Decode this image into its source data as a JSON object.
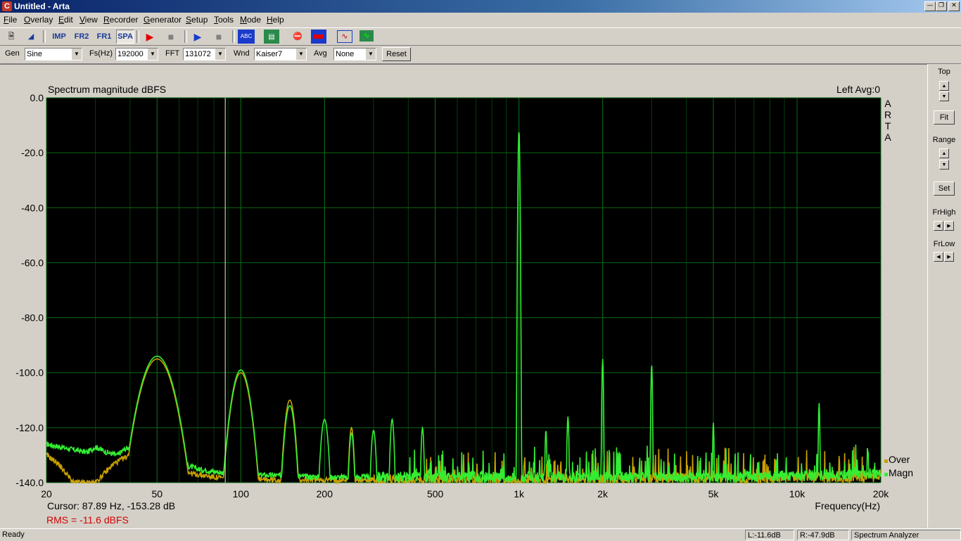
{
  "window": {
    "title": "Untitled - Arta",
    "app_icon": "C",
    "controls": [
      "minimize-icon",
      "restore-icon",
      "close-icon"
    ]
  },
  "menu": [
    {
      "label": "File",
      "u": "F",
      "rest": "ile"
    },
    {
      "label": "Overlay",
      "u": "O",
      "rest": "verlay"
    },
    {
      "label": "Edit",
      "u": "E",
      "rest": "dit"
    },
    {
      "label": "View",
      "u": "V",
      "rest": "iew"
    },
    {
      "label": "Recorder",
      "u": "R",
      "rest": "ecorder"
    },
    {
      "label": "Generator",
      "u": "G",
      "rest": "enerator"
    },
    {
      "label": "Setup",
      "u": "S",
      "rest": "etup"
    },
    {
      "label": "Tools",
      "u": "T",
      "rest": "ools"
    },
    {
      "label": "Mode",
      "u": "M",
      "rest": "ode"
    },
    {
      "label": "Help",
      "u": "H",
      "rest": "elp"
    }
  ],
  "toolbar": {
    "imp_label": "IMP",
    "fr2_label": "FR2",
    "fr1_label": "FR1",
    "spa_label": "SPA",
    "abc_label": "ABC"
  },
  "params": {
    "gen_label": "Gen",
    "gen_value": "Sine",
    "fs_label": "Fs(Hz)",
    "fs_value": "192000",
    "fft_label": "FFT",
    "fft_value": "131072",
    "wnd_label": "Wnd",
    "wnd_value": "Kaiser7",
    "avg_label": "Avg",
    "avg_value": "None",
    "reset_label": "Reset"
  },
  "chart": {
    "title": "Spectrum magnitude dBFS",
    "channel_info": "Left  Avg:0",
    "watermark": [
      "A",
      "R",
      "T",
      "A"
    ],
    "cursor_text": "Cursor: 87.89 Hz, -153.28 dB",
    "rms_text": "RMS =  -11.6 dBFS",
    "xlabel": "Frequency(Hz)",
    "legend": [
      {
        "name": "Over",
        "color": "#c8a000"
      },
      {
        "name": "Magn",
        "color": "#33ee33"
      }
    ],
    "colors": {
      "background": "#000000",
      "grid": "#0a6a14",
      "cursor": "#f0f0c8",
      "magn": "#33ee33",
      "over": "#c8a000",
      "rms": "#d40000"
    }
  },
  "chart_data": {
    "type": "line",
    "title": "Spectrum magnitude dBFS",
    "xlabel": "Frequency(Hz)",
    "ylabel": "",
    "x_scale": "log",
    "xlim": [
      20,
      20000
    ],
    "ylim": [
      -140,
      0
    ],
    "x_ticks": [
      20,
      50,
      100,
      200,
      500,
      1000,
      2000,
      5000,
      10000,
      20000
    ],
    "x_tick_labels": [
      "20",
      "50",
      "100",
      "200",
      "500",
      "1k",
      "2k",
      "5k",
      "10k",
      "20k"
    ],
    "y_ticks": [
      0,
      -20,
      -40,
      -60,
      -80,
      -100,
      -120,
      -140
    ],
    "y_tick_labels": [
      "0.0",
      "-20.0",
      "-40.0",
      "-60.0",
      "-80.0",
      "-100.0",
      "-120.0",
      "-140.0"
    ],
    "grid": true,
    "cursor_x": 87.89,
    "series": [
      {
        "name": "Magn",
        "color": "#33ee33",
        "baseline_points": [
          [
            20,
            -126
          ],
          [
            25,
            -128
          ],
          [
            28,
            -129
          ],
          [
            30,
            -127
          ],
          [
            33,
            -129
          ],
          [
            36,
            -130
          ],
          [
            38,
            -128
          ],
          [
            40,
            -127
          ],
          [
            42,
            -128
          ],
          [
            45,
            -130
          ],
          [
            50,
            -131
          ],
          [
            60,
            -133
          ],
          [
            70,
            -135
          ],
          [
            80,
            -136
          ],
          [
            100,
            -137
          ],
          [
            200,
            -138
          ],
          [
            1000,
            -138
          ],
          [
            5000,
            -138
          ],
          [
            20000,
            -137
          ]
        ],
        "peaks": [
          {
            "f": 50,
            "db": -94,
            "width": 0.06
          },
          {
            "f": 100,
            "db": -99,
            "width": 0.035
          },
          {
            "f": 150,
            "db": -112,
            "width": 0.02
          },
          {
            "f": 200,
            "db": -117,
            "width": 0.015
          },
          {
            "f": 250,
            "db": -122,
            "width": 0.01
          },
          {
            "f": 300,
            "db": -121,
            "width": 0.01
          },
          {
            "f": 350,
            "db": -117,
            "width": 0.008
          },
          {
            "f": 450,
            "db": -120,
            "width": 0.006
          },
          {
            "f": 1000,
            "db": -12,
            "width": 0.003
          },
          {
            "f": 1250,
            "db": -121,
            "width": 0.004
          },
          {
            "f": 1500,
            "db": -116,
            "width": 0.004
          },
          {
            "f": 2000,
            "db": -95,
            "width": 0.003
          },
          {
            "f": 3000,
            "db": -97,
            "width": 0.003
          },
          {
            "f": 5000,
            "db": -118,
            "width": 0.003
          },
          {
            "f": 12000,
            "db": -111,
            "width": 0.003
          }
        ]
      },
      {
        "name": "Over",
        "color": "#c8a000",
        "baseline_points": [
          [
            20,
            -130
          ],
          [
            22,
            -133
          ],
          [
            25,
            -140
          ],
          [
            30,
            -140
          ],
          [
            35,
            -133
          ],
          [
            40,
            -130
          ],
          [
            45,
            -133
          ],
          [
            50,
            -135
          ],
          [
            60,
            -136
          ],
          [
            80,
            -138
          ],
          [
            100,
            -139
          ],
          [
            1000,
            -139
          ],
          [
            20000,
            -138
          ]
        ],
        "peaks": [
          {
            "f": 50,
            "db": -95,
            "width": 0.06
          },
          {
            "f": 100,
            "db": -100,
            "width": 0.035
          },
          {
            "f": 150,
            "db": -110,
            "width": 0.02
          },
          {
            "f": 250,
            "db": -120,
            "width": 0.01
          }
        ]
      }
    ]
  },
  "right_panel": {
    "top_label": "Top",
    "fit_label": "Fit",
    "range_label": "Range",
    "set_label": "Set",
    "frhigh_label": "FrHigh",
    "frlow_label": "FrLow"
  },
  "status": {
    "ready": "Ready",
    "left_level": "L:-11.6dB",
    "right_level": "R:-47.9dB",
    "mode": "Spectrum Analyzer"
  }
}
